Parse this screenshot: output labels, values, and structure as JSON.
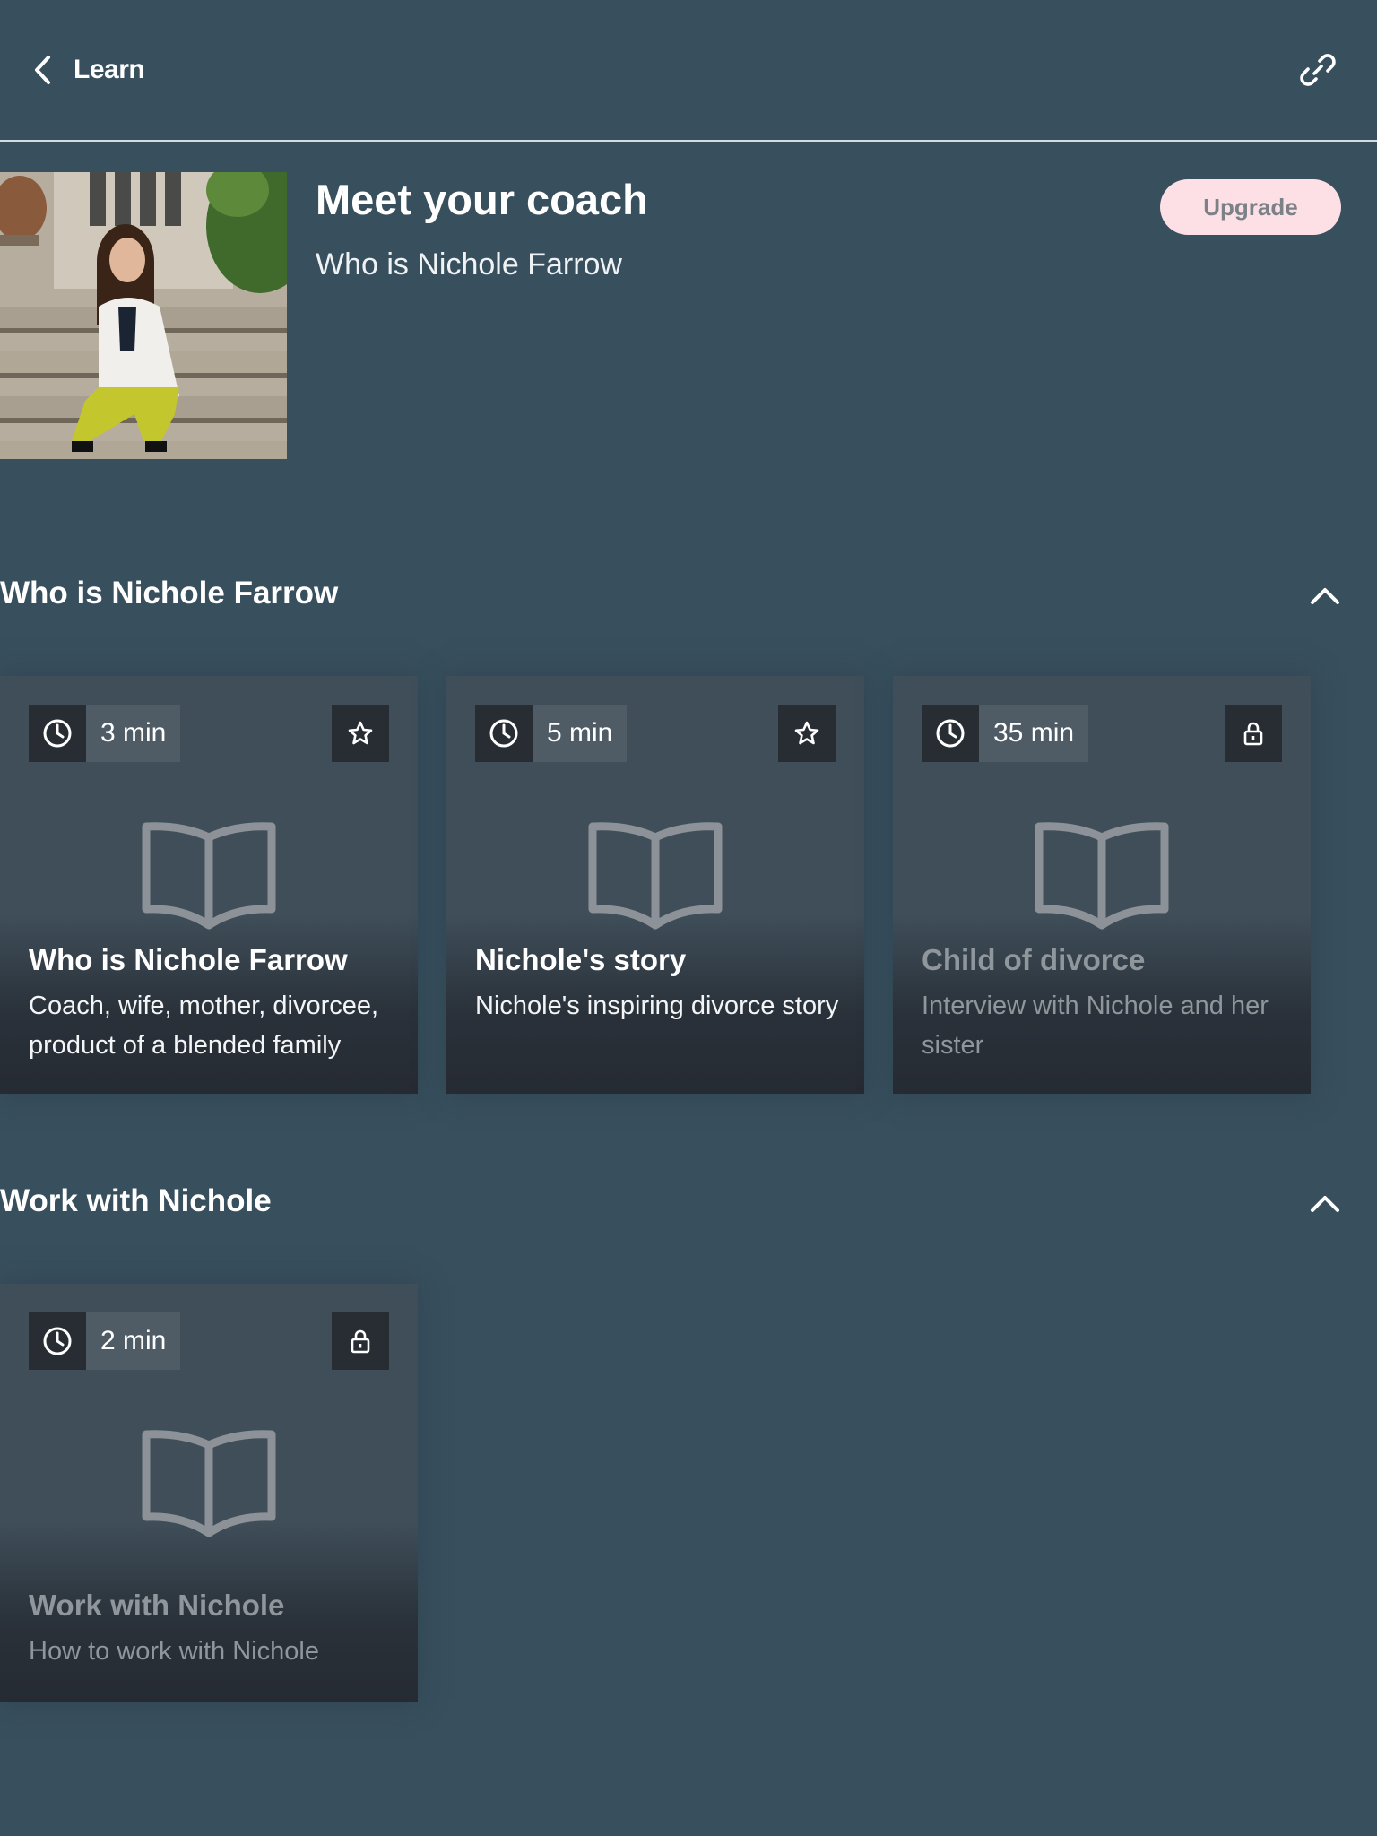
{
  "header": {
    "back_label": "Learn"
  },
  "coach": {
    "title": "Meet your coach",
    "subtitle": "Who is Nichole Farrow",
    "upgrade_label": "Upgrade"
  },
  "sections": [
    {
      "title": "Who is Nichole Farrow",
      "cards": [
        {
          "duration": "3 min",
          "badge": "star-icon",
          "title": "Who is Nichole Farrow",
          "description": "Coach, wife, mother, divorcee, product of a blended family"
        },
        {
          "duration": "5 min",
          "badge": "star-icon",
          "title": "Nichole's story",
          "description": "Nichole's inspiring divorce story"
        },
        {
          "duration": "35 min",
          "badge": "lock-icon",
          "title": "Child of divorce",
          "description": "Interview with Nichole and her sister"
        }
      ]
    },
    {
      "title": "Work with Nichole",
      "cards": [
        {
          "duration": "2 min",
          "badge": "lock-icon",
          "title": "Work with Nichole",
          "description": "How to work with Nichole"
        }
      ]
    }
  ],
  "colors": {
    "background": "#384f5d",
    "upgrade_bg": "#fce0e6",
    "card_bg": "#3f4e59"
  }
}
